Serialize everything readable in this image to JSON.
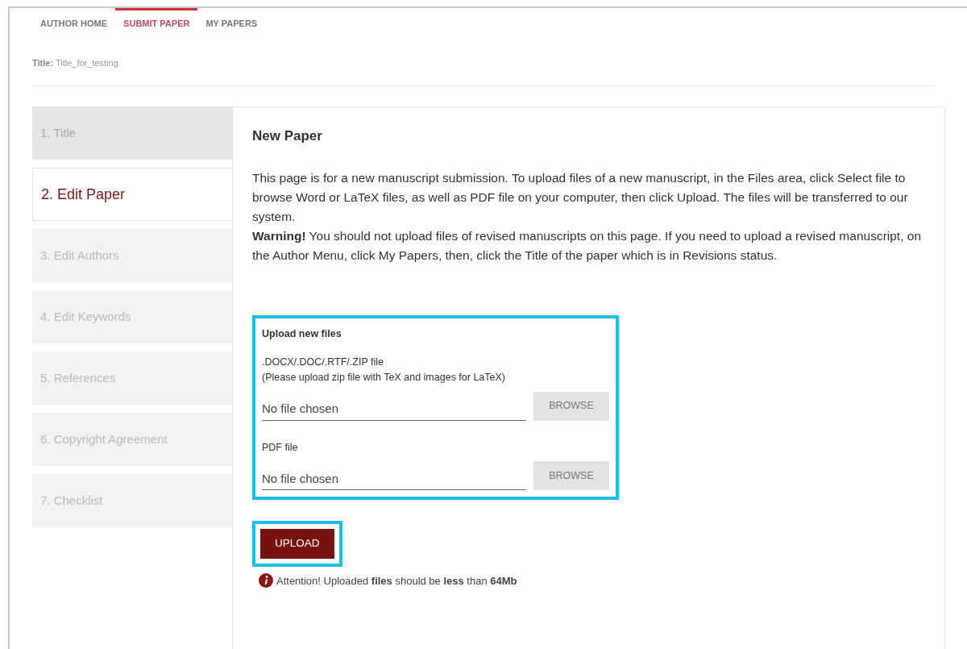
{
  "nav_tabs": [
    {
      "label": "AUTHOR HOME",
      "selected": false
    },
    {
      "label": "SUBMIT PAPER",
      "selected": true
    },
    {
      "label": "MY PAPERS",
      "selected": false
    }
  ],
  "paper_title": {
    "label": "Title:",
    "value": "Title_for_testing"
  },
  "steps": [
    {
      "label": "1. Title",
      "selected": false
    },
    {
      "label": "2. Edit Paper",
      "selected": true
    },
    {
      "label": "3. Edit Authors",
      "selected": false
    },
    {
      "label": "4. Edit Keywords",
      "selected": false
    },
    {
      "label": "5. References",
      "selected": false
    },
    {
      "label": "6. Copyright Agreement",
      "selected": false
    },
    {
      "label": "7. Checklist",
      "selected": false
    }
  ],
  "panel": {
    "heading": "New Paper",
    "intro": "This page is for a new manuscript submission. To upload files of a new manuscript, in the Files area, click Select file to browse Word or LaTeX files, as well as PDF file on your computer, then click Upload. The files will be transferred to our system.",
    "warning": "**Warning!** You should not upload files of revised manuscripts on this page. If you need to upload a revised manuscript, on the Author Menu, click My Papers, then, click the Title of the paper which is in Revisions status.",
    "upload_section": {
      "heading": "Upload new files",
      "highlighted": true,
      "fields": [
        {
          "label": ".DOCX/.DOC/.RTF/.ZIP file",
          "hint": "(Please upload zip file with TeX and images for LaTeX)",
          "value": "No file chosen",
          "button": "BROWSE"
        },
        {
          "label": "PDF file",
          "value": "No file chosen",
          "button": "BROWSE"
        }
      ]
    },
    "upload_button": {
      "label": "UPLOAD",
      "highlighted": true
    },
    "attention": "Attention! Uploaded **files** should be **less** than **64Mb**"
  }
}
